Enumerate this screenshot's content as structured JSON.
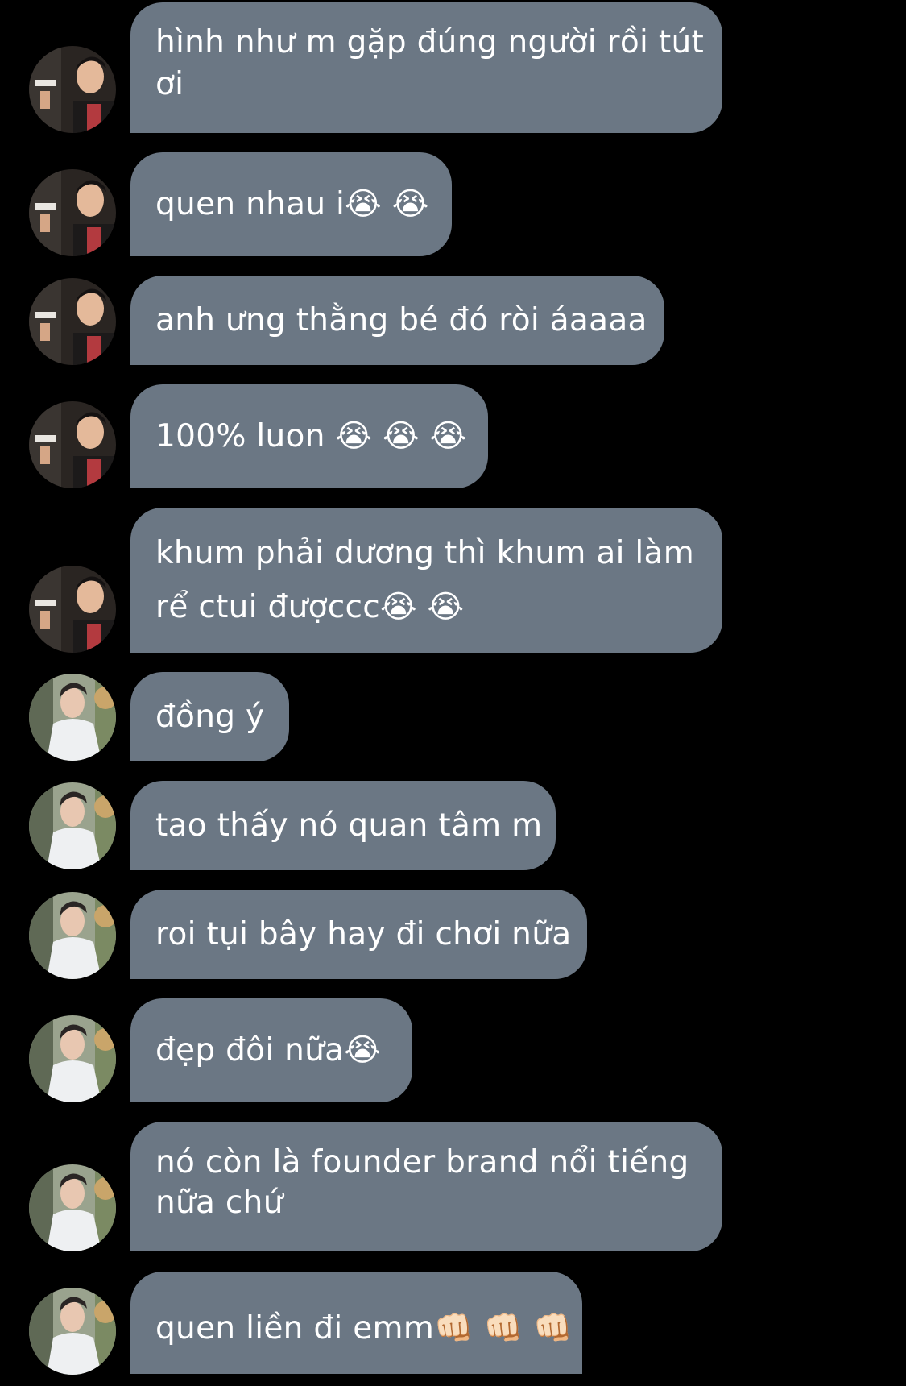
{
  "conversation": {
    "messages": [
      {
        "sender": "friend-a",
        "line1": "hình như m gặp đúng người rồi tút",
        "line2": "ơi",
        "emoji": ""
      },
      {
        "sender": "friend-a",
        "line1": "quen nhau i",
        "line2": "",
        "emoji": "😭 😭"
      },
      {
        "sender": "friend-a",
        "line1": "anh ưng thằng bé đó ròi áaaaa",
        "line2": "",
        "emoji": ""
      },
      {
        "sender": "friend-a",
        "line1": "100% luon ",
        "line2": "",
        "emoji": "😭 😭 😭"
      },
      {
        "sender": "friend-a",
        "line1": "khum phải dương thì khum ai làm",
        "line2": "rể ctui đượccc",
        "emoji": "😭 😭"
      },
      {
        "sender": "friend-b",
        "line1": "đồng ý",
        "line2": "",
        "emoji": ""
      },
      {
        "sender": "friend-b",
        "line1": "tao thấy nó quan tâm m",
        "line2": "",
        "emoji": ""
      },
      {
        "sender": "friend-b",
        "line1": "roi tụi bây hay đi chơi nữa",
        "line2": "",
        "emoji": ""
      },
      {
        "sender": "friend-b",
        "line1": "đẹp đôi nữa",
        "line2": "",
        "emoji": "😭"
      },
      {
        "sender": "friend-b",
        "line1": "nó còn là founder brand nổi tiếng",
        "line2": "nữa chứ",
        "emoji": ""
      },
      {
        "sender": "friend-b",
        "line1": "quen liền đi emm",
        "line2": "",
        "emoji": "👊🏻 👊🏻 👊🏻"
      }
    ]
  },
  "colors": {
    "background": "#000000",
    "bubble": "#6b7784",
    "text": "#ffffff"
  },
  "icons": {
    "crying": "loudly-crying-face-emoji",
    "fist": "oncoming-fist-emoji"
  }
}
